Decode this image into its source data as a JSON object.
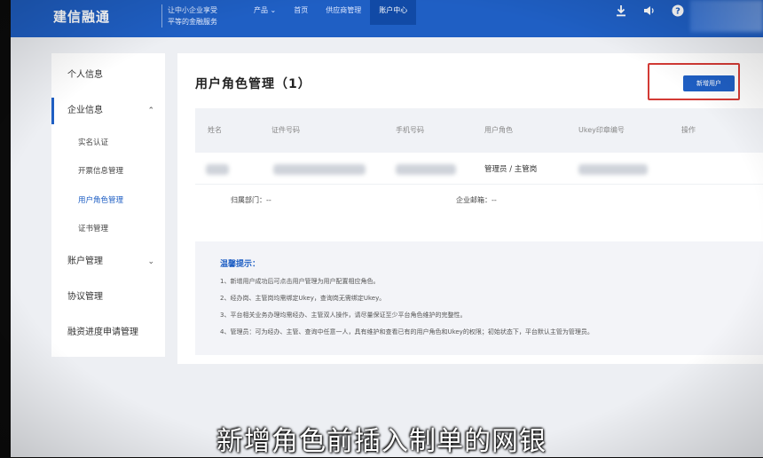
{
  "header": {
    "logo": "建信融通",
    "slogan_line1": "让中小企业享受",
    "slogan_line2": "平等的金融服务",
    "nav": [
      {
        "label": "产品 ⌄"
      },
      {
        "label": "首页"
      },
      {
        "label": "供应商管理"
      },
      {
        "label": "账户中心"
      }
    ],
    "icons": [
      "download-icon",
      "speaker-icon",
      "help-icon"
    ]
  },
  "sidebar": {
    "items": [
      {
        "label": "个人信息"
      },
      {
        "label": "企业信息",
        "chevron": "⌃"
      },
      {
        "label": "账户管理",
        "chevron": "⌄"
      },
      {
        "label": "协议管理"
      },
      {
        "label": "融资进度申请管理"
      }
    ],
    "sub_items": [
      {
        "label": "实名认证"
      },
      {
        "label": "开票信息管理"
      },
      {
        "label": "用户角色管理"
      },
      {
        "label": "证书管理"
      }
    ]
  },
  "main": {
    "title": "用户角色管理（1）",
    "add_button": "新增用户",
    "columns": [
      "姓名",
      "证件号码",
      "手机号码",
      "用户角色",
      "Ukey印章编号",
      "操作"
    ],
    "row": {
      "role": "管理员 / 主管岗",
      "dept_label": "归属部门：--",
      "email_label": "企业邮箱：--"
    },
    "notice": {
      "title": "温馨提示：",
      "lines": [
        "1、新增用户成功后可点击用户管理为用户配置相应角色。",
        "2、经办岗、主管岗均需绑定Ukey，查询岗无需绑定Ukey。",
        "3、平台相关业务办理均需经办、主管双人操作，请尽量保证至少平台角色维护的完整性。",
        "4、管理员：可为经办、主管、查询中任意一人，具有维护和查看已有的用户角色和Ukey的权限；初始状态下，平台默认主管为管理员。"
      ]
    }
  },
  "subtitle": "新增角色前插入制单的网银",
  "colors": {
    "primary": "#1f5fc4",
    "highlight": "#d33a35"
  }
}
